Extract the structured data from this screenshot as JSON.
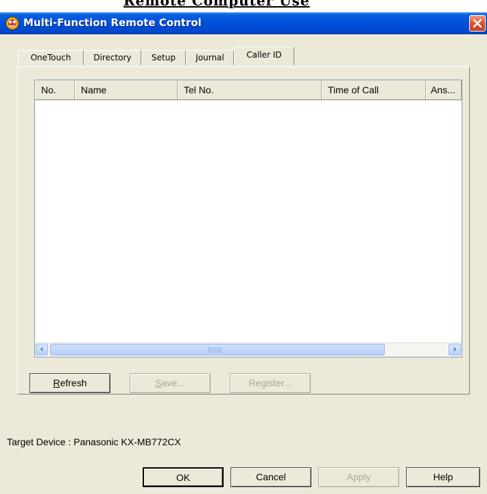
{
  "top_fragment": "Remote Computer Use",
  "window": {
    "title": "Multi-Function Remote Control"
  },
  "tabs": [
    {
      "label": "OneTouch",
      "active": false
    },
    {
      "label": "Directory",
      "active": false
    },
    {
      "label": "Setup",
      "active": false
    },
    {
      "label": "Journal",
      "active": false
    },
    {
      "label": "Caller ID",
      "active": true
    }
  ],
  "list": {
    "columns": [
      "No.",
      "Name",
      "Tel No.",
      "Time of Call",
      "Ans..."
    ],
    "rows": [],
    "scroll_left_icon": "arrow-left",
    "scroll_right_icon": "arrow-right"
  },
  "actions": {
    "refresh": {
      "mnemonic": "R",
      "rest": "efresh",
      "enabled": true
    },
    "save": {
      "mnemonic": "S",
      "rest": "ave...",
      "enabled": false
    },
    "register": {
      "label": "Register...",
      "enabled": false
    }
  },
  "status": {
    "target_device": "Target Device : Panasonic KX-MB772CX"
  },
  "dialog_buttons": {
    "ok": {
      "label": "OK",
      "enabled": true
    },
    "cancel": {
      "label": "Cancel",
      "enabled": true
    },
    "apply": {
      "label": "Apply",
      "enabled": false
    },
    "help": {
      "label": "Help",
      "enabled": true
    }
  },
  "colors": {
    "titlebar": "#0050d8",
    "dialog_face": "#ece9d8",
    "close_button": "#e2542c",
    "disabled_text": "#aca899"
  }
}
